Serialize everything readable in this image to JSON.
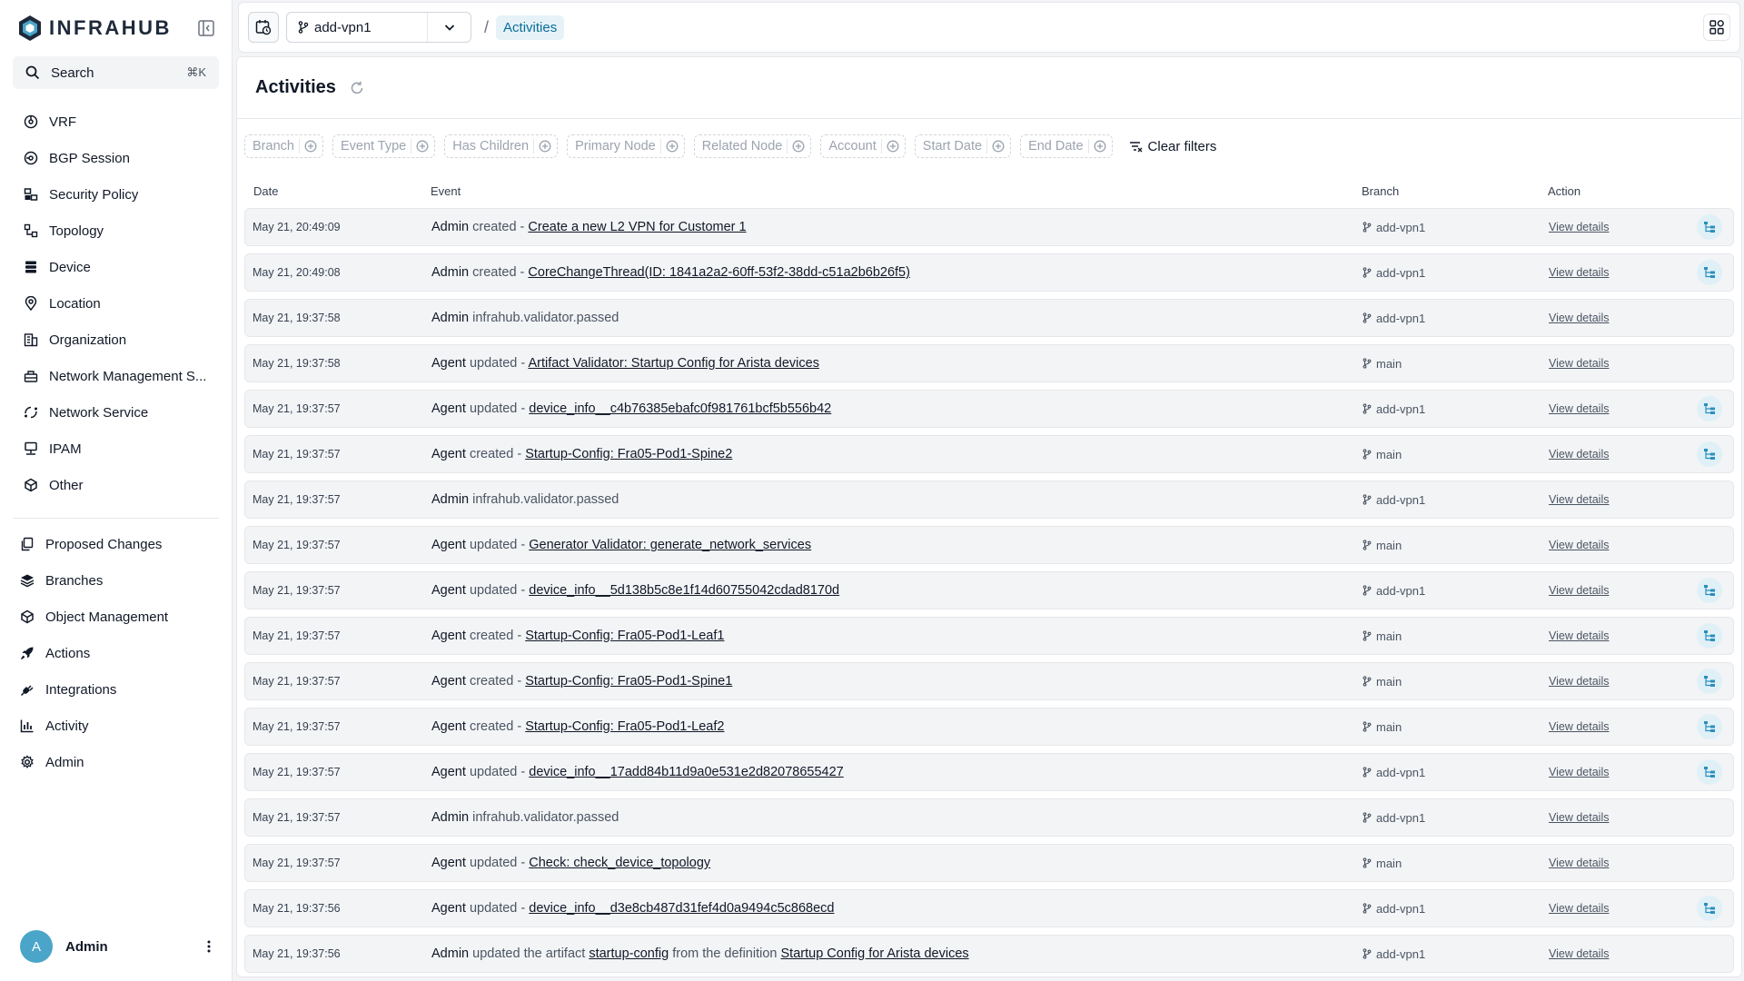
{
  "brand": {
    "name": "INFRAHUB"
  },
  "search": {
    "placeholder": "Search",
    "shortcut": "⌘K"
  },
  "nav_main": [
    {
      "label": "VRF",
      "icon": "vrf-icon"
    },
    {
      "label": "BGP Session",
      "icon": "bgp-icon"
    },
    {
      "label": "Security Policy",
      "icon": "security-policy-icon"
    },
    {
      "label": "Topology",
      "icon": "topology-icon"
    },
    {
      "label": "Device",
      "icon": "device-icon"
    },
    {
      "label": "Location",
      "icon": "location-icon"
    },
    {
      "label": "Organization",
      "icon": "organization-icon"
    },
    {
      "label": "Network Management S...",
      "icon": "network-management-icon"
    },
    {
      "label": "Network Service",
      "icon": "network-service-icon"
    },
    {
      "label": "IPAM",
      "icon": "ipam-icon"
    },
    {
      "label": "Other",
      "icon": "other-icon"
    }
  ],
  "nav_secondary": [
    {
      "label": "Proposed Changes",
      "icon": "proposed-changes-icon"
    },
    {
      "label": "Branches",
      "icon": "branches-icon"
    },
    {
      "label": "Object Management",
      "icon": "object-management-icon"
    },
    {
      "label": "Actions",
      "icon": "actions-icon"
    },
    {
      "label": "Integrations",
      "icon": "integrations-icon"
    },
    {
      "label": "Activity",
      "icon": "activity-icon"
    },
    {
      "label": "Admin",
      "icon": "admin-icon"
    }
  ],
  "user": {
    "initial": "A",
    "name": "Admin"
  },
  "topbar": {
    "branch": "add-vpn1",
    "separator": "/",
    "breadcrumb": "Activities"
  },
  "page": {
    "title": "Activities"
  },
  "filters": [
    "Branch",
    "Event Type",
    "Has Children",
    "Primary Node",
    "Related Node",
    "Account",
    "Start Date",
    "End Date"
  ],
  "clear_filters": "Clear filters",
  "table": {
    "headers": {
      "date": "Date",
      "event": "Event",
      "branch": "Branch",
      "action": "Action"
    },
    "rows": [
      {
        "date": "May 21, 20:49:09",
        "actor": "Admin",
        "verb": "created -",
        "link": "Create a new L2 VPN for Customer 1",
        "branch": "add-vpn1",
        "action": "View details",
        "tree": true
      },
      {
        "date": "May 21, 20:49:08",
        "actor": "Admin",
        "verb": "created -",
        "link": "CoreChangeThread(ID: 1841a2a2-60ff-53f2-38dd-c51a2b6b26f5)",
        "branch": "add-vpn1",
        "action": "View details",
        "tree": true
      },
      {
        "date": "May 21, 19:37:58",
        "actor": "Admin",
        "verb": "infrahub.validator.passed",
        "link": "",
        "branch": "add-vpn1",
        "action": "View details",
        "tree": false
      },
      {
        "date": "May 21, 19:37:58",
        "actor": "Agent",
        "verb": "updated -",
        "link": "Artifact Validator: Startup Config for Arista devices",
        "branch": "main",
        "action": "View details",
        "tree": false
      },
      {
        "date": "May 21, 19:37:57",
        "actor": "Agent",
        "verb": "updated -",
        "link": "device_info__c4b76385ebafc0f981761bcf5b556b42",
        "branch": "add-vpn1",
        "action": "View details",
        "tree": true
      },
      {
        "date": "May 21, 19:37:57",
        "actor": "Agent",
        "verb": "created -",
        "link": "Startup-Config: Fra05-Pod1-Spine2",
        "branch": "main",
        "action": "View details",
        "tree": true
      },
      {
        "date": "May 21, 19:37:57",
        "actor": "Admin",
        "verb": "infrahub.validator.passed",
        "link": "",
        "branch": "add-vpn1",
        "action": "View details",
        "tree": false
      },
      {
        "date": "May 21, 19:37:57",
        "actor": "Agent",
        "verb": "updated -",
        "link": "Generator Validator: generate_network_services",
        "branch": "main",
        "action": "View details",
        "tree": false
      },
      {
        "date": "May 21, 19:37:57",
        "actor": "Agent",
        "verb": "updated -",
        "link": "device_info__5d138b5c8e1f14d60755042cdad8170d",
        "branch": "add-vpn1",
        "action": "View details",
        "tree": true
      },
      {
        "date": "May 21, 19:37:57",
        "actor": "Agent",
        "verb": "created -",
        "link": "Startup-Config: Fra05-Pod1-Leaf1",
        "branch": "main",
        "action": "View details",
        "tree": true
      },
      {
        "date": "May 21, 19:37:57",
        "actor": "Agent",
        "verb": "created -",
        "link": "Startup-Config: Fra05-Pod1-Spine1",
        "branch": "main",
        "action": "View details",
        "tree": true
      },
      {
        "date": "May 21, 19:37:57",
        "actor": "Agent",
        "verb": "created -",
        "link": "Startup-Config: Fra05-Pod1-Leaf2",
        "branch": "main",
        "action": "View details",
        "tree": true
      },
      {
        "date": "May 21, 19:37:57",
        "actor": "Agent",
        "verb": "updated -",
        "link": "device_info__17add84b11d9a0e531e2d82078655427",
        "branch": "add-vpn1",
        "action": "View details",
        "tree": true
      },
      {
        "date": "May 21, 19:37:57",
        "actor": "Admin",
        "verb": "infrahub.validator.passed",
        "link": "",
        "branch": "add-vpn1",
        "action": "View details",
        "tree": false
      },
      {
        "date": "May 21, 19:37:57",
        "actor": "Agent",
        "verb": "updated -",
        "link": "Check: check_device_topology",
        "branch": "main",
        "action": "View details",
        "tree": false
      },
      {
        "date": "May 21, 19:37:56",
        "actor": "Agent",
        "verb": "updated -",
        "link": "device_info__d3e8cb487d31fef4d0a9494c5c868ecd",
        "branch": "add-vpn1",
        "action": "View details",
        "tree": true
      },
      {
        "date": "May 21, 19:37:56",
        "actor": "Admin",
        "verb": "updated the artifact",
        "link": "startup-config",
        "verb2": "from the definition",
        "link2": "Startup Config for Arista devices",
        "branch": "add-vpn1",
        "action": "View details",
        "tree": false
      }
    ]
  },
  "colors": {
    "accent": "#0a6e99",
    "avatar": "#4aa5c9",
    "tree_bg": "#e0f0f7"
  }
}
